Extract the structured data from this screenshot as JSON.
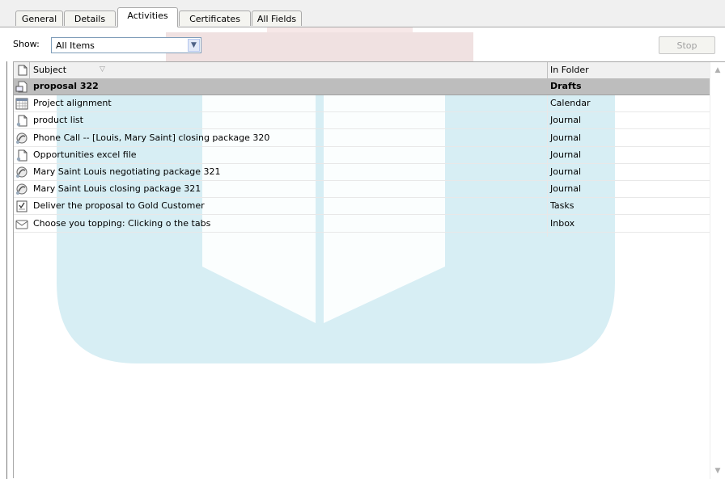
{
  "tabs": [
    {
      "label": "General"
    },
    {
      "label": "Details"
    },
    {
      "label": "Activities",
      "active": true
    },
    {
      "label": "Certificates"
    },
    {
      "label": "All Fields"
    }
  ],
  "show": {
    "label": "Show:",
    "selected": "All Items"
  },
  "stop_label": "Stop",
  "columns": {
    "subject": "Subject",
    "folder": "In Folder"
  },
  "rows": [
    {
      "subject": "proposal 322",
      "folder": "Drafts",
      "icon": "draft-icon",
      "selected": true
    },
    {
      "subject": "Project alignment",
      "folder": "Calendar",
      "icon": "calendar-icon"
    },
    {
      "subject": "product list",
      "folder": "Journal",
      "icon": "journal-document-icon"
    },
    {
      "subject": "Phone Call -- [Louis, Mary Saint] closing package 320",
      "folder": "Journal",
      "icon": "phone-call-icon"
    },
    {
      "subject": "Opportunities excel file",
      "folder": "Journal",
      "icon": "journal-document-icon"
    },
    {
      "subject": "Mary Saint Louis negotiating package 321",
      "folder": "Journal",
      "icon": "phone-call-icon"
    },
    {
      "subject": "Mary Saint Louis  closing package 321",
      "folder": "Journal",
      "icon": "phone-call-icon"
    },
    {
      "subject": "Deliver the proposal to Gold Customer",
      "folder": "Tasks",
      "icon": "task-icon"
    },
    {
      "subject": "Choose you topping:  Clicking o the tabs",
      "folder": "Inbox",
      "icon": "envelope-icon"
    }
  ],
  "colors": {
    "selected_row": "#bdbdbd",
    "watermark": "#d7eef4",
    "watermark_red": "#e8c7c7"
  }
}
